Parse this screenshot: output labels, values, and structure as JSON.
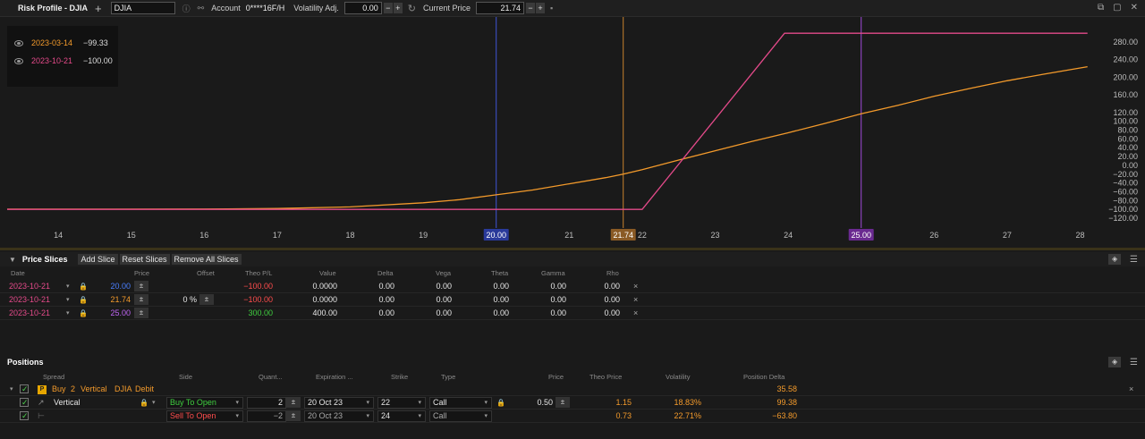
{
  "toolbar": {
    "title": "Risk Profile - DJIA",
    "symbol_value": "DJIA",
    "account_label": "Account",
    "account_value": "0****16F/H",
    "volatility_label": "Volatility Adj.",
    "volatility_value": "0.00",
    "current_price_label": "Current Price",
    "current_price_value": "21.74",
    "minus": "−",
    "plus": "+"
  },
  "legend": [
    {
      "date": "2023-03-14",
      "value": "−99.33",
      "color": "#f39a2b"
    },
    {
      "date": "2023-10-21",
      "value": "−100.00",
      "color": "#e44a8a"
    }
  ],
  "chart_data": {
    "type": "line",
    "xlim": [
      13.3,
      28.3
    ],
    "ylim": [
      -130,
      310
    ],
    "x_ticks": [
      14,
      15,
      16,
      17,
      18,
      19,
      20,
      21,
      22,
      23,
      24,
      25,
      26,
      27,
      28
    ],
    "y_ticks": [
      -120,
      -100,
      -80,
      -60,
      -40,
      -20,
      0,
      20,
      40,
      60,
      80,
      100,
      120,
      160,
      200,
      240,
      280
    ],
    "y_tick_labels": [
      "−120.00",
      "−100.00",
      "−80.00",
      "−60.00",
      "−40.00",
      "−20.00",
      "0.00",
      "20.00",
      "40.00",
      "60.00",
      "80.00",
      "100.00",
      "120.00",
      "160.00",
      "200.00",
      "240.00",
      "280.00"
    ],
    "series": [
      {
        "color": "#f39a2b",
        "x": [
          13.3,
          16,
          17,
          18,
          19,
          19.5,
          20,
          20.5,
          21,
          21.5,
          21.74,
          22,
          22.5,
          23,
          23.5,
          24,
          24.5,
          25,
          25.5,
          26,
          26.5,
          27,
          27.5,
          28.1
        ],
        "y": [
          -99.5,
          -99.3,
          -98,
          -94.5,
          -85,
          -78,
          -67,
          -56,
          -42,
          -28,
          -20,
          -10,
          12,
          33,
          54,
          74,
          95,
          117,
          136,
          157,
          175,
          192,
          207,
          224
        ]
      },
      {
        "color": "#e44a8a",
        "x": [
          13.3,
          22,
          23.95,
          28.1
        ],
        "y": [
          -100,
          -100,
          300,
          300
        ]
      }
    ],
    "vlines": [
      {
        "x": 20.0,
        "label": "20.00",
        "color": "#3f54d6",
        "label_bg": "#2a3a9a"
      },
      {
        "x": 21.74,
        "label": "21.74",
        "color": "#c7822c",
        "label_bg": "#8a5a25"
      },
      {
        "x": 25.0,
        "label": "25.00",
        "color": "#a04ad8",
        "label_bg": "#6a2a90"
      }
    ]
  },
  "price_slices": {
    "title": "Price Slices",
    "buttons": [
      "Add Slice",
      "Reset Slices",
      "Remove All Slices"
    ],
    "columns": [
      "Date",
      "Price",
      "Offset",
      "Theo P/L",
      "Value",
      "Delta",
      "Vega",
      "Theta",
      "Gamma",
      "Rho"
    ],
    "rows": [
      {
        "date": "2023-10-21",
        "price": "20.00",
        "price_color": "#4a7fff",
        "offset": "",
        "pl": "−100.00",
        "pl_color": "#ff4d4d",
        "value": "0.0000",
        "delta": "0.00",
        "vega": "0.00",
        "theta": "0.00",
        "gamma": "0.00",
        "rho": "0.00"
      },
      {
        "date": "2023-10-21",
        "price": "21.74",
        "price_color": "#f39a2b",
        "offset": "0 %",
        "pl": "−100.00",
        "pl_color": "#ff4d4d",
        "value": "0.0000",
        "delta": "0.00",
        "vega": "0.00",
        "theta": "0.00",
        "gamma": "0.00",
        "rho": "0.00"
      },
      {
        "date": "2023-10-21",
        "price": "25.00",
        "price_color": "#c065f5",
        "offset": "",
        "pl": "300.00",
        "pl_color": "#3fcf3f",
        "value": "400.00",
        "delta": "0.00",
        "vega": "0.00",
        "theta": "0.00",
        "gamma": "0.00",
        "rho": "0.00"
      }
    ],
    "remove": "×",
    "pm": "±"
  },
  "positions": {
    "title": "Positions",
    "columns": [
      "Spread",
      "Side",
      "Quant...",
      "Expiration ...",
      "Strike",
      "Type",
      "Price",
      "Theo Price",
      "Volatility",
      "Position Delta"
    ],
    "group": {
      "badge": "P",
      "buy": "Buy",
      "qty": "2",
      "spread": "Vertical",
      "symbol": "DJIA",
      "kind": "Debit",
      "position_delta": "35.58"
    },
    "legs": [
      {
        "spread": "Vertical",
        "side": "Buy To Open",
        "qty": "2",
        "expiration": "20 Oct 23",
        "strike": "22",
        "type": "Call",
        "price": "0.50",
        "theo": "1.15",
        "vol": "18.83%",
        "delta": "99.38"
      },
      {
        "spread": "",
        "side": "Sell To Open",
        "qty": "−2",
        "expiration": "20 Oct 23",
        "strike": "24",
        "type": "Call",
        "price": "",
        "theo": "0.73",
        "vol": "22.71%",
        "delta": "−63.80"
      }
    ],
    "remove": "×"
  }
}
